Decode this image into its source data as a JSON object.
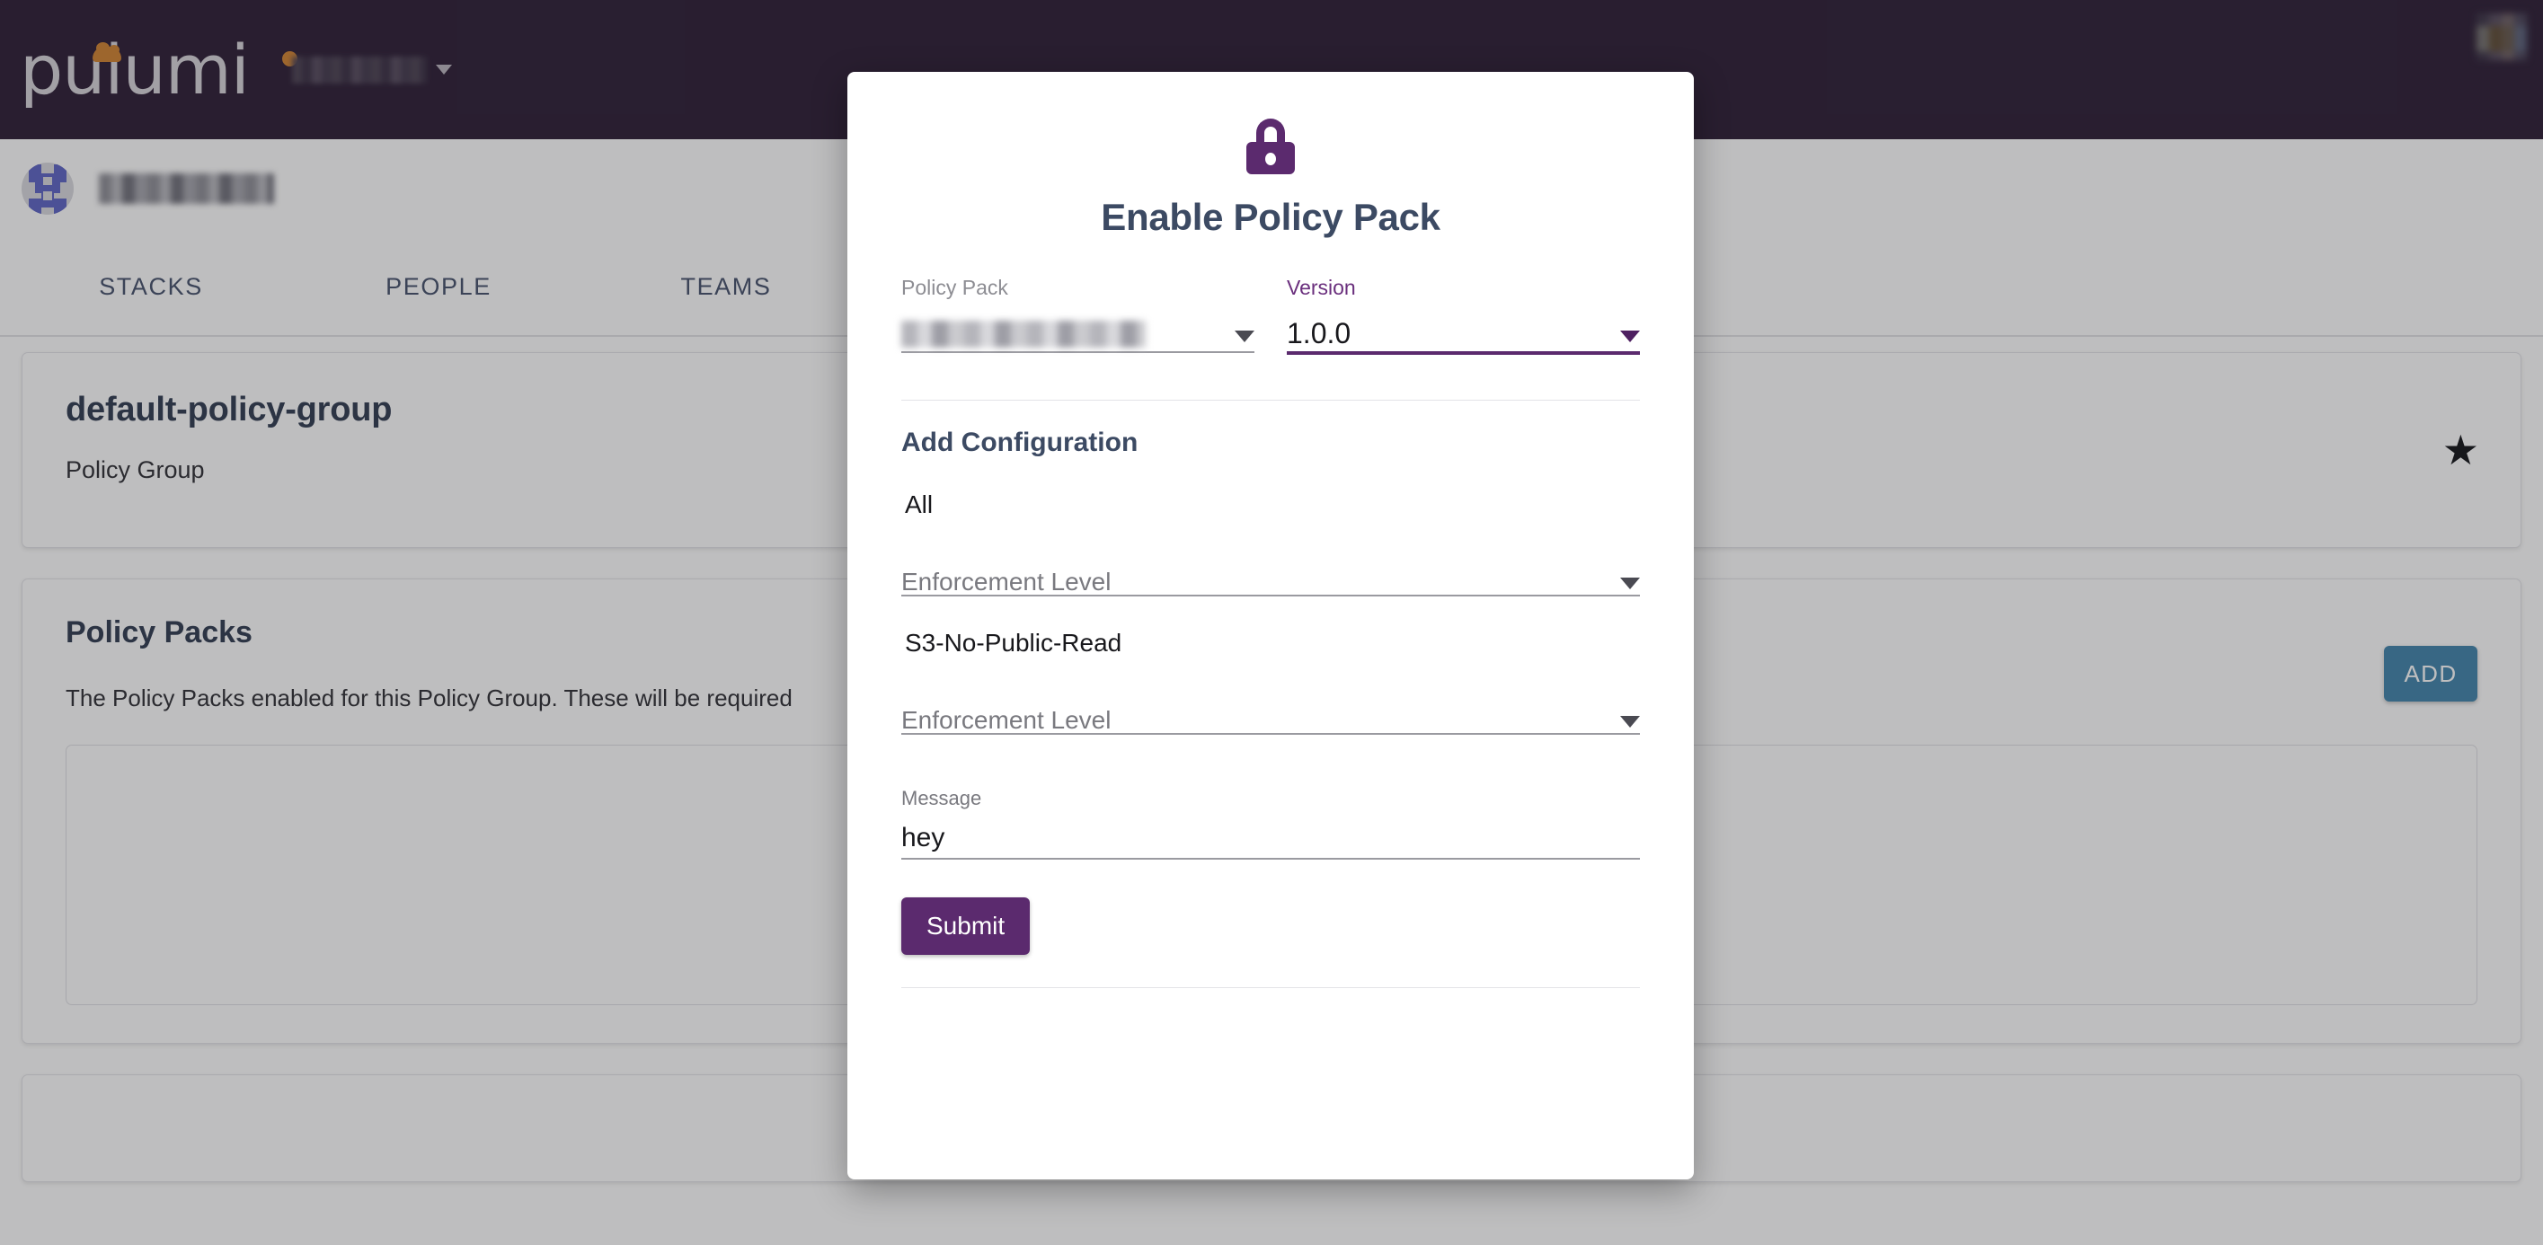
{
  "topbar": {
    "logo_text": "pulumi",
    "logo_cloud_color": "#d0812f",
    "background_color": "#2a1b33",
    "org_switcher_label": "",
    "caret_icon": "chevron-down-icon",
    "user_avatar": "user-avatar"
  },
  "orgbar": {
    "org_avatar": "org-identicon",
    "org_name": ""
  },
  "tabs": [
    {
      "label": "STACKS"
    },
    {
      "label": "PEOPLE"
    },
    {
      "label": "TEAMS"
    }
  ],
  "policy_group_card": {
    "title": "default-policy-group",
    "subtitle": "Policy Group",
    "star_icon": "★"
  },
  "policy_packs_card": {
    "title": "Policy Packs",
    "description": "The Policy Packs enabled for this Policy Group. These will be required",
    "add_button": "ADD",
    "add_button_color": "#3f83ab"
  },
  "modal": {
    "icon": "lock-icon",
    "icon_color": "#5b2a6e",
    "title": "Enable Policy Pack",
    "policy_pack": {
      "label": "Policy Pack",
      "value": "",
      "label_color": "#8d8d93"
    },
    "version": {
      "label": "Version",
      "value": "1.0.0",
      "label_color": "#6a2f7d",
      "underline_color": "#5b2a6e"
    },
    "section_title": "Add Configuration",
    "configs": [
      {
        "name": "All",
        "enforcement_placeholder": "Enforcement Level",
        "enforcement_value": ""
      },
      {
        "name": "S3-No-Public-Read",
        "enforcement_placeholder": "Enforcement Level",
        "enforcement_value": ""
      }
    ],
    "message": {
      "label": "Message",
      "value": "hey"
    },
    "submit_label": "Submit",
    "submit_color": "#5b2a6e"
  }
}
